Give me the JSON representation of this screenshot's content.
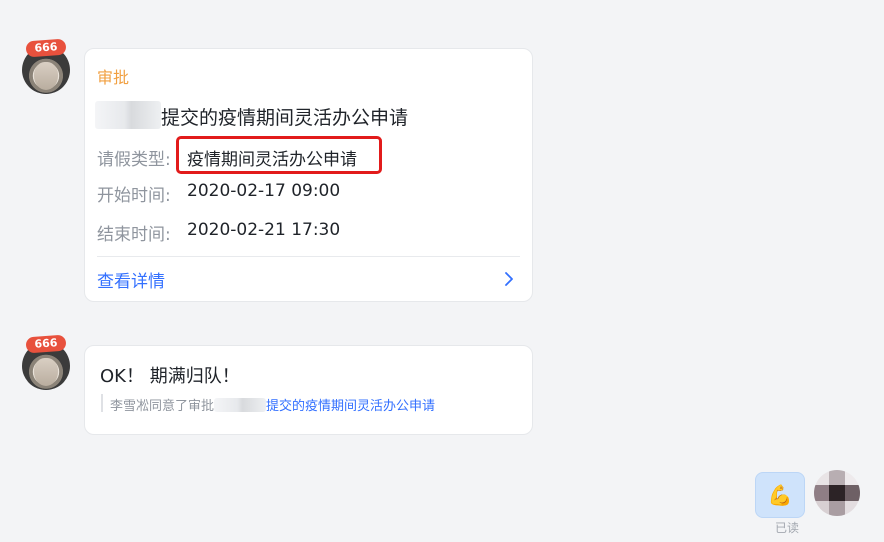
{
  "messages": [
    {
      "avatar_badge": "666",
      "card": {
        "app_label": "审批",
        "title": "提交的疫情期间灵活办公申请",
        "fields": [
          {
            "label": "请假类型:",
            "value": "疫情期间灵活办公申请"
          },
          {
            "label": "开始时间:",
            "value": "2020-02-17 09:00"
          },
          {
            "label": "结束时间:",
            "value": "2020-02-21 17:30"
          }
        ],
        "detail_link": "查看详情"
      }
    },
    {
      "avatar_badge": "666",
      "text": "OK！ 期满归队！",
      "quote_prefix": "李雪凇同意了审批",
      "quote_link": "提交的疫情期间灵活办公申请"
    }
  ],
  "self": {
    "reaction_icon": "💪",
    "read_status": "已读"
  },
  "colors": {
    "accent_blue": "#3370ff",
    "app_label_orange": "#f1a042",
    "highlight_red": "#e21b1b"
  }
}
